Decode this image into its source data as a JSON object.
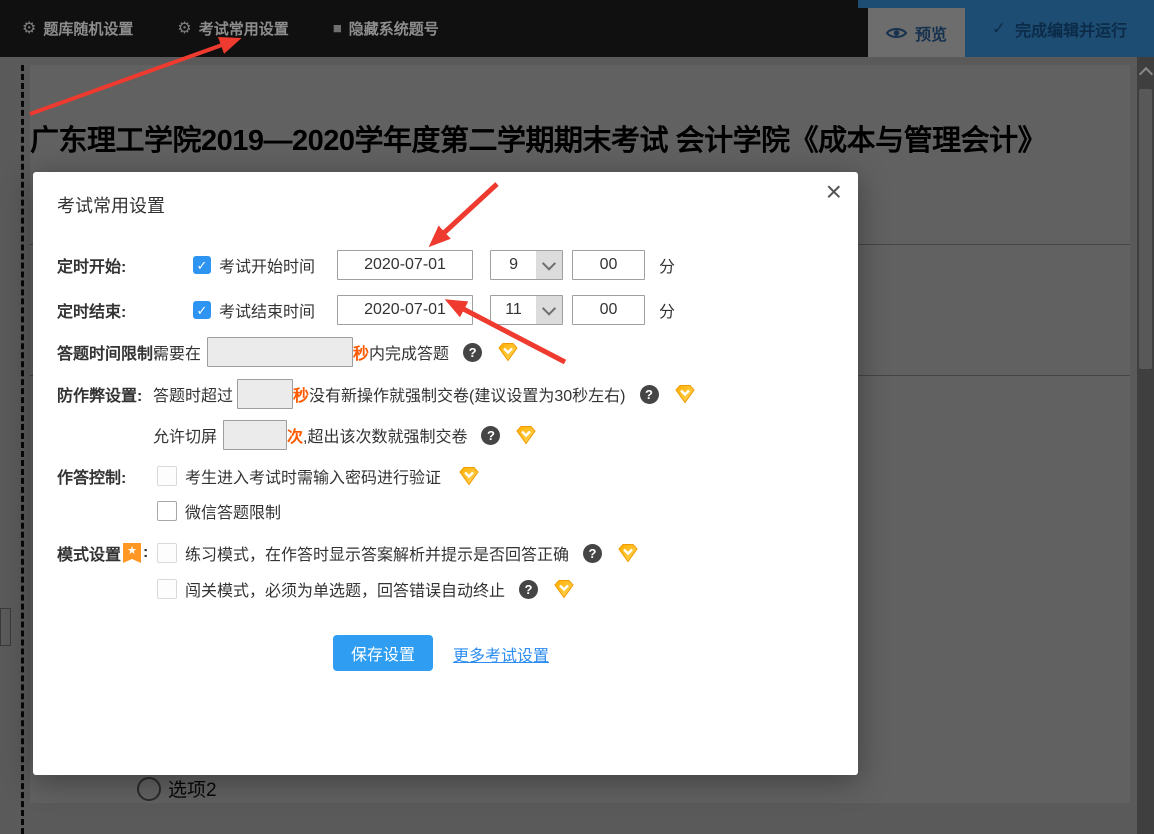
{
  "colors": {
    "accent_blue": "#2e94f1",
    "orange_highlight": "#ff5a00",
    "arrow_red": "#ef3b2f",
    "finish_navy": "#1d4d72",
    "badge_orange": "#ff9724",
    "gem_yellow": "#ffc53d"
  },
  "icons": {
    "gear": "⚙",
    "square": "■",
    "check": "✓",
    "question": "?",
    "close": "×",
    "star": "★"
  },
  "topbar": {
    "items": [
      {
        "label": "题库随机设置"
      },
      {
        "label": "考试常用设置"
      },
      {
        "label": "隐藏系统题号"
      }
    ],
    "preview": "预览",
    "finish": "完成编辑并运行"
  },
  "page": {
    "exam_title": "广东理工学院2019—2020学年度第二学期期末考试 会计学院《成本与管理会计》",
    "option_label": "选项2"
  },
  "modal": {
    "title": "考试常用设置",
    "start": {
      "label": "定时开始:",
      "time_label": "考试开始时间",
      "date": "2020-07-01",
      "hour": "9",
      "minute": "00",
      "unit": "分"
    },
    "end": {
      "label": "定时结束:",
      "time_label": "考试结束时间",
      "date": "2020-07-01",
      "hour": "11",
      "minute": "00",
      "unit": "分"
    },
    "time_limit": {
      "label": "答题时间限制:",
      "before": "需要在",
      "unit": "秒",
      "after": "内完成答题"
    },
    "anti_cheat": {
      "label": "防作弊设置:",
      "line1_before": "答题时超过",
      "line1_unit": "秒",
      "line1_after": "没有新操作就强制交卷(建议设置为30秒左右)",
      "line2_before": "允许切屏",
      "line2_unit": "次",
      "line2_after": ",超出该次数就强制交卷"
    },
    "answer_control": {
      "label": "作答控制:",
      "password": "考生进入考试时需输入密码进行验证",
      "wechat": "微信答题限制"
    },
    "mode": {
      "label": "模式设置",
      "colon": ":",
      "practice": "练习模式，在作答时显示答案解析并提示是否回答正确",
      "challenge": "闯关模式，必须为单选题，回答错误自动终止"
    },
    "save": "保存设置",
    "more": "更多考试设置"
  }
}
